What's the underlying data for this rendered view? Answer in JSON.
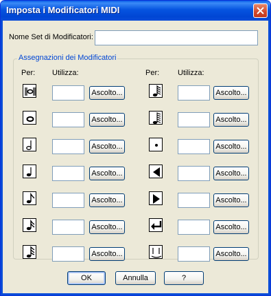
{
  "window": {
    "title": "Imposta i Modificatori MIDI"
  },
  "name_field": {
    "label": "Nome Set di Modificatori:",
    "value": ""
  },
  "group": {
    "title": "Assegnazioni dei Modificatori",
    "per_label": "Per:",
    "utilizza_label": "Utilizza:"
  },
  "listen_label": "Ascolto...",
  "rows_left": [
    {
      "icon": "double-whole-note-icon",
      "value": ""
    },
    {
      "icon": "whole-note-icon",
      "value": ""
    },
    {
      "icon": "half-note-icon",
      "value": ""
    },
    {
      "icon": "quarter-note-icon",
      "value": ""
    },
    {
      "icon": "eighth-note-icon",
      "value": ""
    },
    {
      "icon": "sixteenth-note-icon",
      "value": ""
    },
    {
      "icon": "thirty-second-note-icon",
      "value": ""
    }
  ],
  "rows_right": [
    {
      "icon": "sixty-fourth-note-icon",
      "value": ""
    },
    {
      "icon": "hundred-twenty-eighth-note-icon",
      "value": ""
    },
    {
      "icon": "dot-icon",
      "value": ""
    },
    {
      "icon": "left-arrow-icon",
      "value": ""
    },
    {
      "icon": "right-arrow-icon",
      "value": ""
    },
    {
      "icon": "enter-icon",
      "value": ""
    },
    {
      "icon": "tie-icon",
      "value": ""
    }
  ],
  "buttons": {
    "ok": "OK",
    "cancel": "Annulla",
    "help": "?"
  }
}
